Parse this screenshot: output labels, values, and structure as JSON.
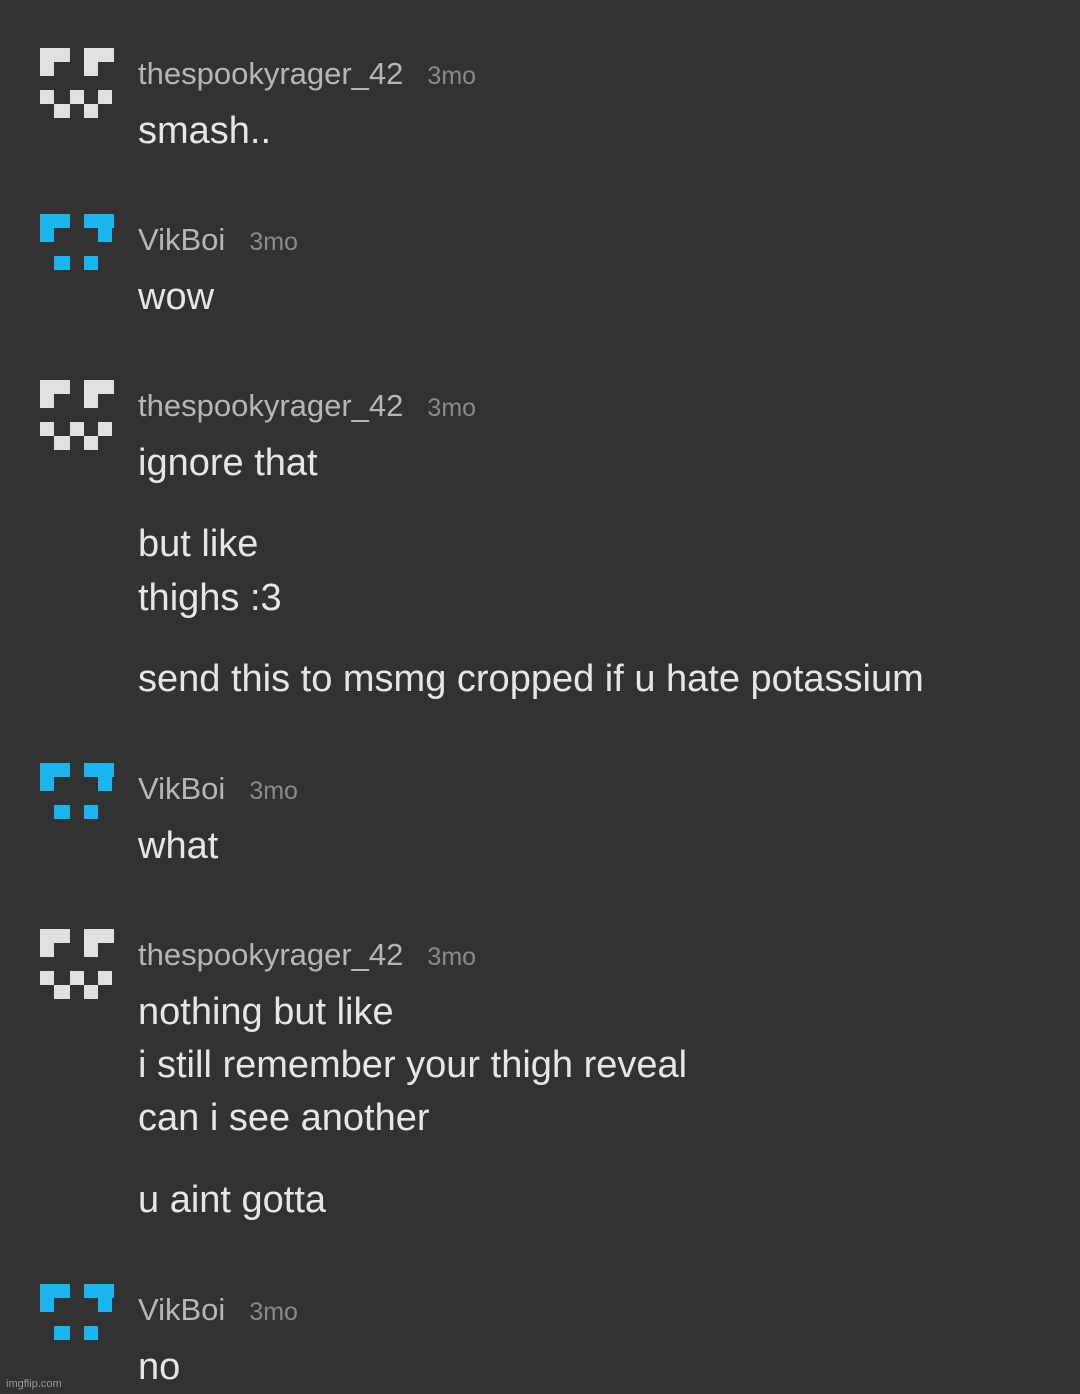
{
  "colors": {
    "background": "#323232",
    "username": "#b6b6b6",
    "timestamp": "#8a8a8a",
    "message_text": "#e6e6e6",
    "avatar_gray": "#e0e0e0",
    "avatar_blue": "#1ab4ee"
  },
  "messages": [
    {
      "user": "thespookyrager_42",
      "time": "3mo",
      "avatar": "gray-pixel-face",
      "lines": [
        "smash.."
      ]
    },
    {
      "user": "VikBoi",
      "time": "3mo",
      "avatar": "blue-pixel-face",
      "lines": [
        "wow"
      ]
    },
    {
      "user": "thespookyrager_42",
      "time": "3mo",
      "avatar": "gray-pixel-face",
      "lines": [
        "ignore that",
        "but like",
        "thighs :3",
        "send this to msmg cropped if u hate potassium"
      ]
    },
    {
      "user": "VikBoi",
      "time": "3mo",
      "avatar": "blue-pixel-face",
      "lines": [
        "what"
      ]
    },
    {
      "user": "thespookyrager_42",
      "time": "3mo",
      "avatar": "gray-pixel-face",
      "lines": [
        "nothing but like",
        "i still remember your thigh reveal",
        "can i see another",
        "u aint gotta"
      ]
    },
    {
      "user": "VikBoi",
      "time": "3mo",
      "avatar": "blue-pixel-face",
      "lines": [
        "no"
      ]
    }
  ],
  "watermark": "imgflip.com"
}
